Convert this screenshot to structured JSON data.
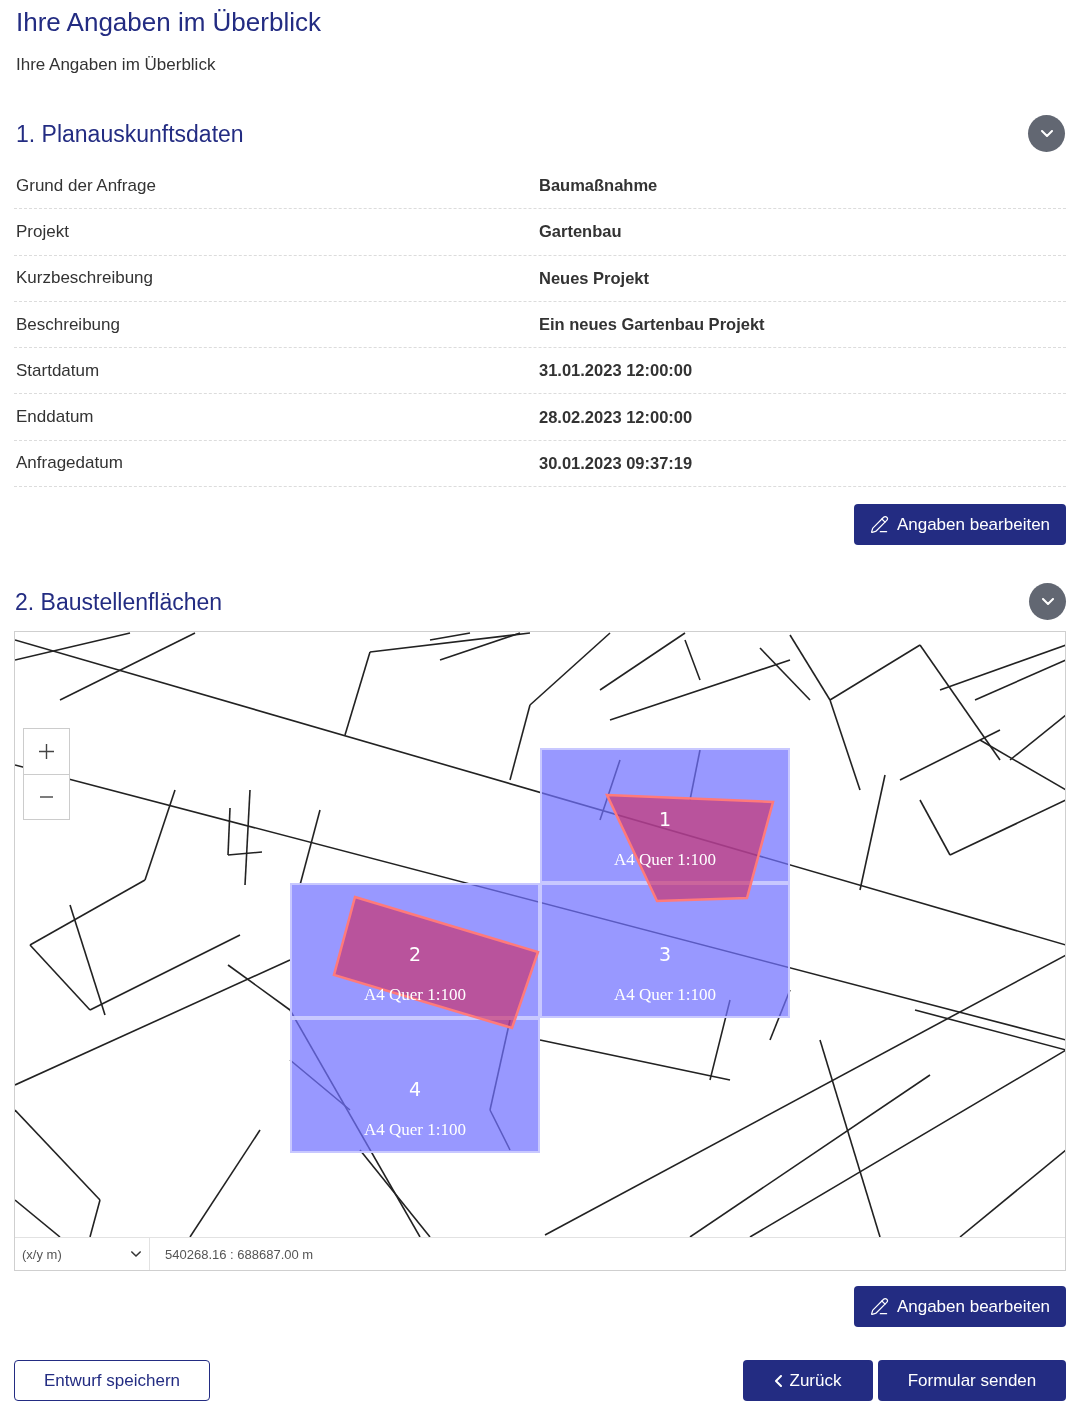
{
  "page": {
    "title": "Ihre Angaben im Überblick",
    "subtitle": "Ihre Angaben im Überblick"
  },
  "sections": [
    {
      "kind": "details",
      "heading": "1. Planauskunftsdaten",
      "rows": [
        {
          "label": "Grund der Anfrage",
          "value": "Baumaßnahme"
        },
        {
          "label": "Projekt",
          "value": "Gartenbau"
        },
        {
          "label": "Kurzbeschreibung",
          "value": "Neues Projekt"
        },
        {
          "label": "Beschreibung",
          "value": "Ein neues Gartenbau Projekt"
        },
        {
          "label": "Startdatum",
          "value": "31.01.2023 12:00:00"
        },
        {
          "label": "Enddatum",
          "value": "28.02.2023 12:00:00"
        },
        {
          "label": "Anfragedatum",
          "value": "30.01.2023 09:37:19"
        }
      ],
      "edit_button": "Angaben bearbeiten"
    },
    {
      "kind": "map",
      "heading": "2. Baustellenflächen",
      "map": {
        "sheets": [
          {
            "number": "1",
            "format": "A4 Quer 1:100"
          },
          {
            "number": "2",
            "format": "A4 Quer 1:100"
          },
          {
            "number": "3",
            "format": "A4 Quer 1:100"
          },
          {
            "number": "4",
            "format": "A4 Quer 1:100"
          }
        ],
        "coordinate_system": "(x/y m)",
        "coordinates": "540268.16 : 688687.00 m"
      },
      "edit_button": "Angaben bearbeiten"
    }
  ],
  "footer": {
    "save_draft": "Entwurf speichern",
    "back": "Zurück",
    "submit": "Formular senden"
  }
}
